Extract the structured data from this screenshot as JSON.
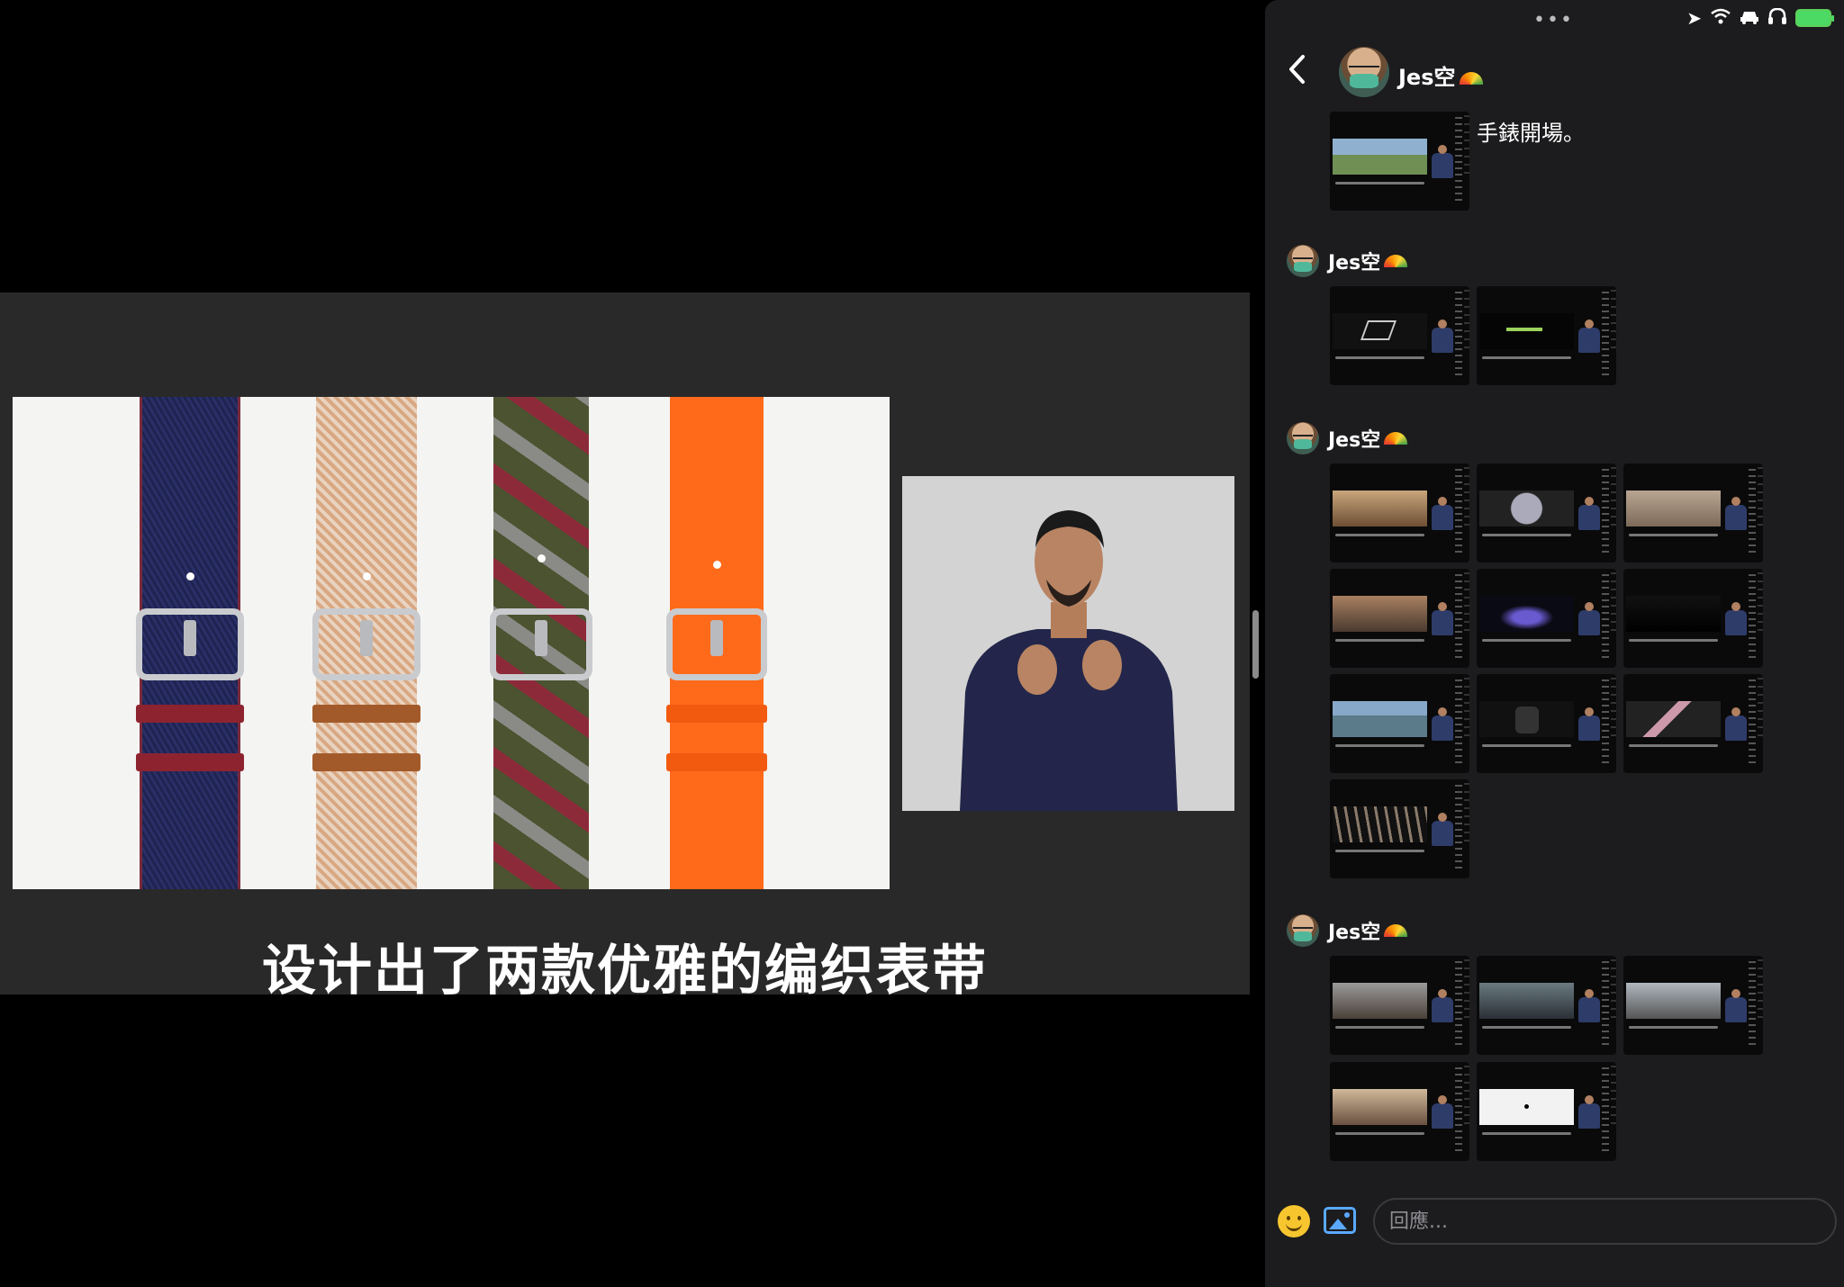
{
  "video": {
    "subtitle": "设计出了两款优雅的编织表带"
  },
  "status_bar": {
    "dots": "•••",
    "location_icon": "location-arrow-icon",
    "wifi_icon": "wifi-icon",
    "car_icon": "car-icon",
    "headphones_icon": "headphones-icon",
    "battery_icon": "battery-charging-icon",
    "battery_color": "#4cd964"
  },
  "chat": {
    "contact_name": "Jes空",
    "first_message_text": "手錶開場。",
    "groups": [
      {
        "sender": "Jes空",
        "thumb_count": 2
      },
      {
        "sender": "Jes空",
        "thumb_count": 10
      },
      {
        "sender": "Jes空",
        "thumb_count": 5
      }
    ]
  },
  "composer": {
    "placeholder": "回應..."
  },
  "colors": {
    "chat_background": "#1c1c1e",
    "video_frame": "#292929",
    "accent_blue": "#5aa9ff"
  }
}
